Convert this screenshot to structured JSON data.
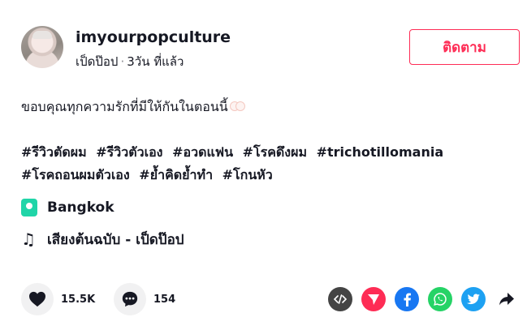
{
  "header": {
    "username": "imyourpopculture",
    "display_name": "เป็ดป๊อป",
    "separator": "·",
    "posted": "3วัน ที่แล้ว",
    "follow_label": "ติดตาม"
  },
  "caption": {
    "text": "ขอบคุณทุกความรักที่มีให้กันในตอนนี้"
  },
  "hashtags": [
    "#รีวิวตัดผม",
    "#รีวิวตัวเอง",
    "#อวดแฟน",
    "#โรคดึงผม",
    "#trichotillomania",
    "#โรคถอนผมตัวเอง",
    "#ย้ำคิดย้ำทำ",
    "#โกนหัว"
  ],
  "location": {
    "name": "Bangkok",
    "icon": "location-pin-icon"
  },
  "music": {
    "title": "เสียงต้นฉบับ - เป็ดป๊อป",
    "icon": "music-note-icon"
  },
  "actions": {
    "likes": "15.5K",
    "comments": "154"
  },
  "share": [
    {
      "name": "embed-icon",
      "color": "#444444"
    },
    {
      "name": "send-icon",
      "color": "#fe2c55"
    },
    {
      "name": "facebook-icon",
      "color": "#1877f2"
    },
    {
      "name": "whatsapp-icon",
      "color": "#25d366"
    },
    {
      "name": "twitter-icon",
      "color": "#1da1f2"
    },
    {
      "name": "share-arrow-icon",
      "color": "#161823"
    }
  ]
}
